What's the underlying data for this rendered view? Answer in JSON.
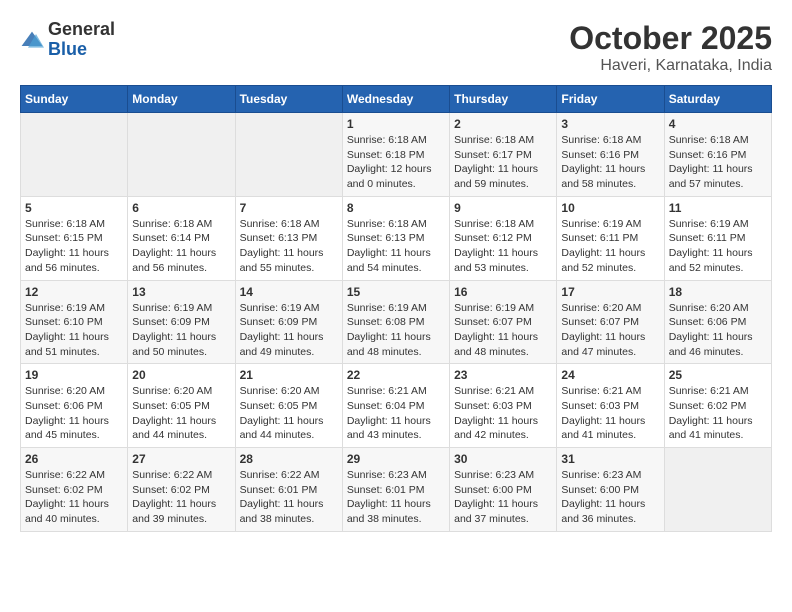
{
  "logo": {
    "general": "General",
    "blue": "Blue"
  },
  "title": "October 2025",
  "subtitle": "Haveri, Karnataka, India",
  "weekdays": [
    "Sunday",
    "Monday",
    "Tuesday",
    "Wednesday",
    "Thursday",
    "Friday",
    "Saturday"
  ],
  "weeks": [
    [
      {
        "day": "",
        "info": ""
      },
      {
        "day": "",
        "info": ""
      },
      {
        "day": "",
        "info": ""
      },
      {
        "day": "1",
        "info": "Sunrise: 6:18 AM\nSunset: 6:18 PM\nDaylight: 12 hours\nand 0 minutes."
      },
      {
        "day": "2",
        "info": "Sunrise: 6:18 AM\nSunset: 6:17 PM\nDaylight: 11 hours\nand 59 minutes."
      },
      {
        "day": "3",
        "info": "Sunrise: 6:18 AM\nSunset: 6:16 PM\nDaylight: 11 hours\nand 58 minutes."
      },
      {
        "day": "4",
        "info": "Sunrise: 6:18 AM\nSunset: 6:16 PM\nDaylight: 11 hours\nand 57 minutes."
      }
    ],
    [
      {
        "day": "5",
        "info": "Sunrise: 6:18 AM\nSunset: 6:15 PM\nDaylight: 11 hours\nand 56 minutes."
      },
      {
        "day": "6",
        "info": "Sunrise: 6:18 AM\nSunset: 6:14 PM\nDaylight: 11 hours\nand 56 minutes."
      },
      {
        "day": "7",
        "info": "Sunrise: 6:18 AM\nSunset: 6:13 PM\nDaylight: 11 hours\nand 55 minutes."
      },
      {
        "day": "8",
        "info": "Sunrise: 6:18 AM\nSunset: 6:13 PM\nDaylight: 11 hours\nand 54 minutes."
      },
      {
        "day": "9",
        "info": "Sunrise: 6:18 AM\nSunset: 6:12 PM\nDaylight: 11 hours\nand 53 minutes."
      },
      {
        "day": "10",
        "info": "Sunrise: 6:19 AM\nSunset: 6:11 PM\nDaylight: 11 hours\nand 52 minutes."
      },
      {
        "day": "11",
        "info": "Sunrise: 6:19 AM\nSunset: 6:11 PM\nDaylight: 11 hours\nand 52 minutes."
      }
    ],
    [
      {
        "day": "12",
        "info": "Sunrise: 6:19 AM\nSunset: 6:10 PM\nDaylight: 11 hours\nand 51 minutes."
      },
      {
        "day": "13",
        "info": "Sunrise: 6:19 AM\nSunset: 6:09 PM\nDaylight: 11 hours\nand 50 minutes."
      },
      {
        "day": "14",
        "info": "Sunrise: 6:19 AM\nSunset: 6:09 PM\nDaylight: 11 hours\nand 49 minutes."
      },
      {
        "day": "15",
        "info": "Sunrise: 6:19 AM\nSunset: 6:08 PM\nDaylight: 11 hours\nand 48 minutes."
      },
      {
        "day": "16",
        "info": "Sunrise: 6:19 AM\nSunset: 6:07 PM\nDaylight: 11 hours\nand 48 minutes."
      },
      {
        "day": "17",
        "info": "Sunrise: 6:20 AM\nSunset: 6:07 PM\nDaylight: 11 hours\nand 47 minutes."
      },
      {
        "day": "18",
        "info": "Sunrise: 6:20 AM\nSunset: 6:06 PM\nDaylight: 11 hours\nand 46 minutes."
      }
    ],
    [
      {
        "day": "19",
        "info": "Sunrise: 6:20 AM\nSunset: 6:06 PM\nDaylight: 11 hours\nand 45 minutes."
      },
      {
        "day": "20",
        "info": "Sunrise: 6:20 AM\nSunset: 6:05 PM\nDaylight: 11 hours\nand 44 minutes."
      },
      {
        "day": "21",
        "info": "Sunrise: 6:20 AM\nSunset: 6:05 PM\nDaylight: 11 hours\nand 44 minutes."
      },
      {
        "day": "22",
        "info": "Sunrise: 6:21 AM\nSunset: 6:04 PM\nDaylight: 11 hours\nand 43 minutes."
      },
      {
        "day": "23",
        "info": "Sunrise: 6:21 AM\nSunset: 6:03 PM\nDaylight: 11 hours\nand 42 minutes."
      },
      {
        "day": "24",
        "info": "Sunrise: 6:21 AM\nSunset: 6:03 PM\nDaylight: 11 hours\nand 41 minutes."
      },
      {
        "day": "25",
        "info": "Sunrise: 6:21 AM\nSunset: 6:02 PM\nDaylight: 11 hours\nand 41 minutes."
      }
    ],
    [
      {
        "day": "26",
        "info": "Sunrise: 6:22 AM\nSunset: 6:02 PM\nDaylight: 11 hours\nand 40 minutes."
      },
      {
        "day": "27",
        "info": "Sunrise: 6:22 AM\nSunset: 6:02 PM\nDaylight: 11 hours\nand 39 minutes."
      },
      {
        "day": "28",
        "info": "Sunrise: 6:22 AM\nSunset: 6:01 PM\nDaylight: 11 hours\nand 38 minutes."
      },
      {
        "day": "29",
        "info": "Sunrise: 6:23 AM\nSunset: 6:01 PM\nDaylight: 11 hours\nand 38 minutes."
      },
      {
        "day": "30",
        "info": "Sunrise: 6:23 AM\nSunset: 6:00 PM\nDaylight: 11 hours\nand 37 minutes."
      },
      {
        "day": "31",
        "info": "Sunrise: 6:23 AM\nSunset: 6:00 PM\nDaylight: 11 hours\nand 36 minutes."
      },
      {
        "day": "",
        "info": ""
      }
    ]
  ]
}
